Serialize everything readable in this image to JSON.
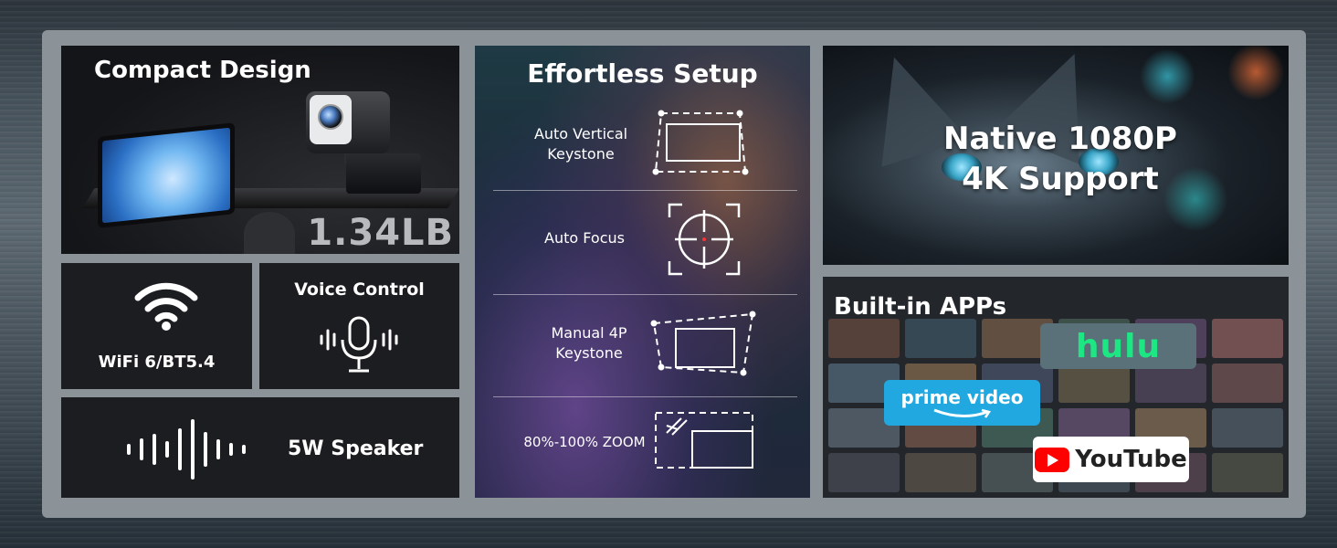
{
  "compact": {
    "title": "Compact Design",
    "weight": "1.34LB"
  },
  "wifi": {
    "label": "WiFi 6/BT5.4",
    "icon": "wifi-icon"
  },
  "voice": {
    "label": "Voice Control",
    "icon": "microphone-icon"
  },
  "speaker": {
    "label": "5W Speaker",
    "icon": "sound-wave-icon"
  },
  "setup": {
    "title": "Effortless Setup",
    "rows": [
      {
        "label": "Auto Vertical\nKeystone",
        "icon": "vertical-keystone-icon"
      },
      {
        "label": "Auto Focus",
        "icon": "focus-crosshair-icon"
      },
      {
        "label": "Manual 4P\nKeystone",
        "icon": "four-point-keystone-icon"
      },
      {
        "label": "80%-100% ZOOM",
        "icon": "zoom-icon"
      }
    ]
  },
  "display": {
    "line1": "Native 1080P",
    "line2": "4K Support"
  },
  "apps": {
    "title": "Built-in APPs",
    "hulu": "hulu",
    "prime": "prime video",
    "youtube": "YouTube"
  },
  "colors": {
    "hulu_green": "#1ce783",
    "prime_blue": "#21a8e0",
    "youtube_red": "#ff0000",
    "frame": "#8b9298"
  }
}
